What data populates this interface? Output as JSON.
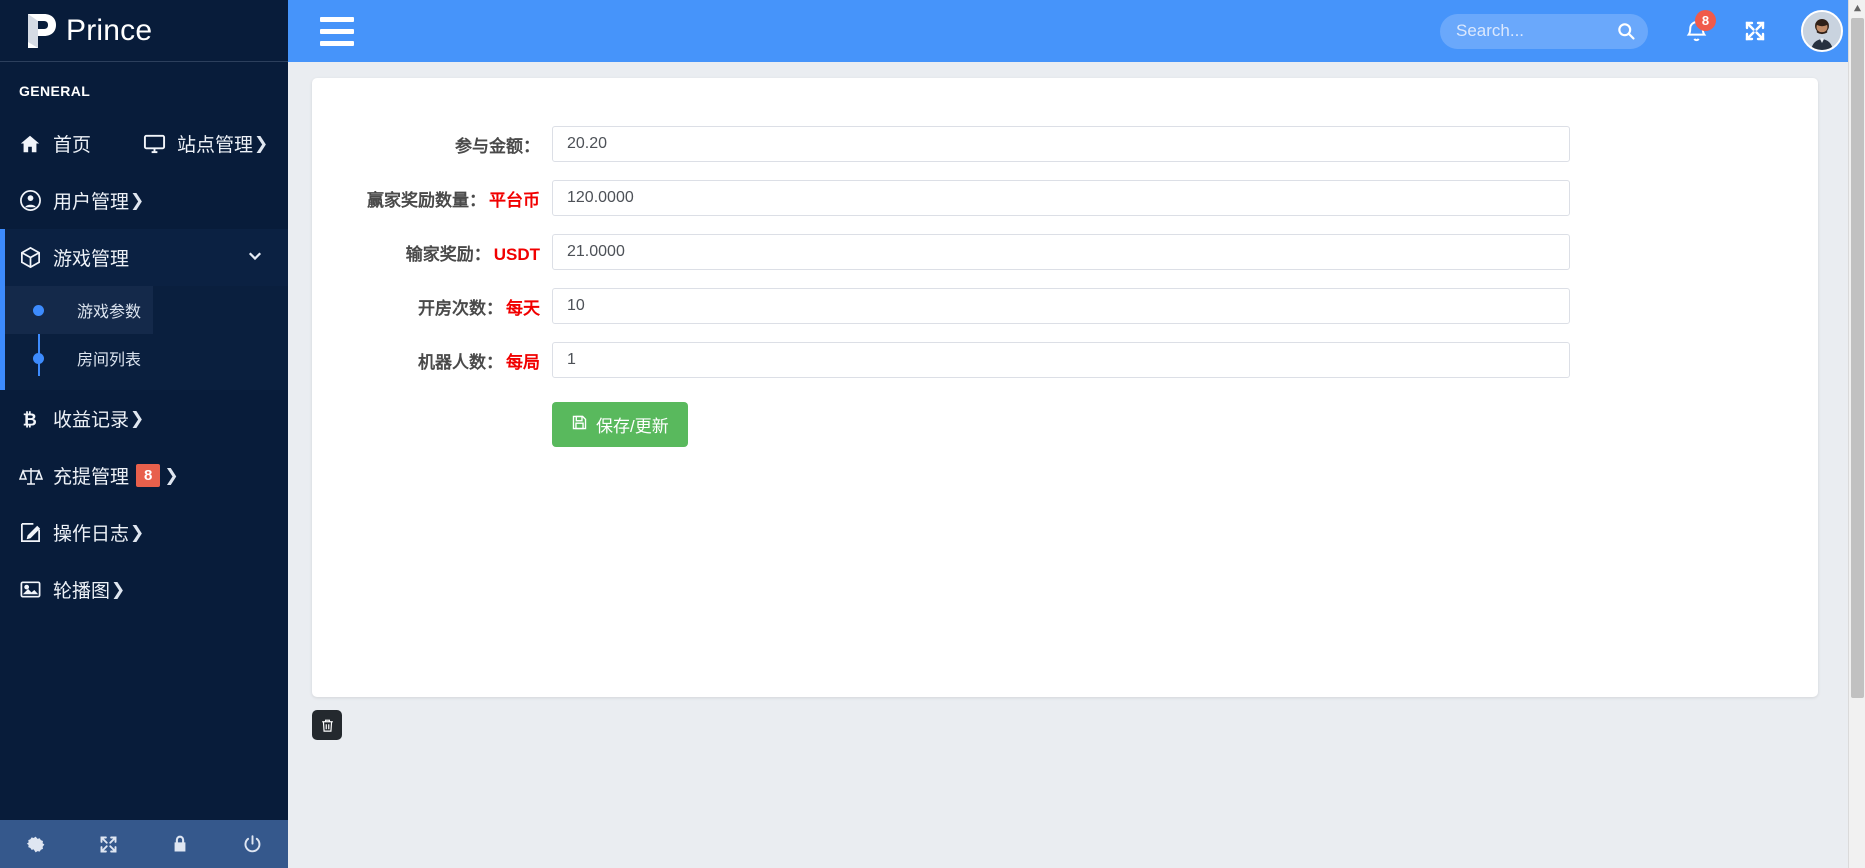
{
  "brand": {
    "name": "Prince",
    "logo_icon": "prince-logo-icon"
  },
  "sidebar": {
    "section_title": "GENERAL",
    "items": [
      {
        "label": "首页",
        "icon": "home-icon",
        "has_caret": false
      },
      {
        "label": "站点管理",
        "icon": "monitor-icon",
        "has_caret": true
      },
      {
        "label": "用户管理",
        "icon": "user-circle-icon",
        "has_caret": true
      },
      {
        "label": "游戏管理",
        "icon": "cube-icon",
        "has_caret": false,
        "expanded": true,
        "chevron": "chevron-down-icon"
      },
      {
        "label": "收益记录",
        "icon": "bitcoin-icon",
        "has_caret": true
      },
      {
        "label": "充提管理",
        "icon": "scales-icon",
        "has_caret": true,
        "badge": "8"
      },
      {
        "label": "操作日志",
        "icon": "edit-square-icon",
        "has_caret": true
      },
      {
        "label": "轮播图",
        "icon": "image-icon",
        "has_caret": true
      }
    ],
    "submenu": [
      {
        "label": "游戏参数",
        "active": true
      },
      {
        "label": "房间列表",
        "active": false
      }
    ],
    "footer_icons": [
      "gear-icon",
      "expand-icon",
      "lock-icon",
      "power-icon"
    ]
  },
  "topbar": {
    "menu_toggle_icon": "hamburger-icon",
    "search": {
      "placeholder": "Search...",
      "value": "",
      "icon": "search-icon"
    },
    "notifications": {
      "icon": "bell-icon",
      "count": "8"
    },
    "fullscreen_icon": "fullscreen-icon",
    "avatar_icon": "user-avatar"
  },
  "form": {
    "rows": [
      {
        "label": "参与金额：",
        "unit": "",
        "value": "20.20"
      },
      {
        "label": "赢家奖励数量：",
        "unit": "平台币",
        "value": "120.0000"
      },
      {
        "label": "输家奖励：",
        "unit": "USDT",
        "value": "21.0000"
      },
      {
        "label": "开房次数：",
        "unit": "每天",
        "value": "10"
      },
      {
        "label": "机器人数：",
        "unit": "每局",
        "value": "1"
      }
    ],
    "save_label": "保存/更新",
    "save_icon": "floppy-disk-icon"
  },
  "trash": {
    "icon": "trash-icon"
  },
  "colors": {
    "sidebar_bg": "#081c3a",
    "topbar_blue": "#4694fa",
    "accent_blue": "#3d8bfd",
    "unit_red": "#f10000",
    "badge_red": "#e8604c",
    "save_green": "#59b95d",
    "page_bg": "#eaedf1"
  }
}
